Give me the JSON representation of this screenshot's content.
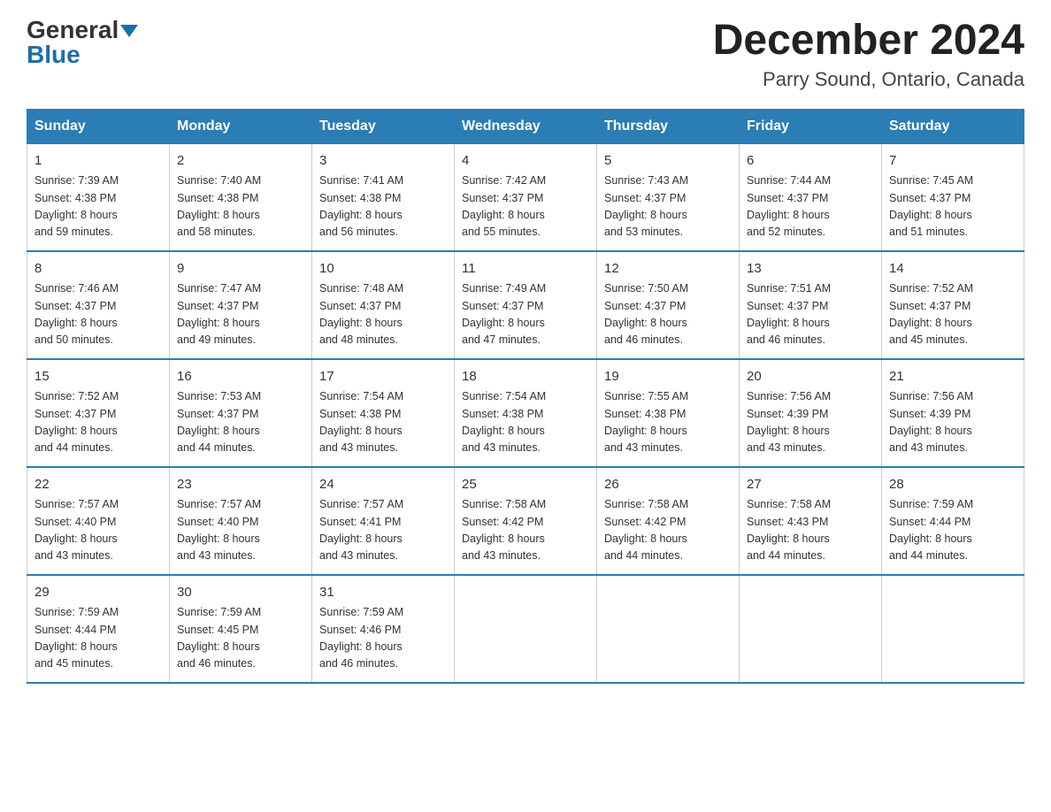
{
  "logo": {
    "general": "General",
    "blue": "Blue"
  },
  "title": "December 2024",
  "location": "Parry Sound, Ontario, Canada",
  "weekdays": [
    "Sunday",
    "Monday",
    "Tuesday",
    "Wednesday",
    "Thursday",
    "Friday",
    "Saturday"
  ],
  "weeks": [
    [
      {
        "day": "1",
        "sunrise": "7:39 AM",
        "sunset": "4:38 PM",
        "daylight": "8 hours and 59 minutes."
      },
      {
        "day": "2",
        "sunrise": "7:40 AM",
        "sunset": "4:38 PM",
        "daylight": "8 hours and 58 minutes."
      },
      {
        "day": "3",
        "sunrise": "7:41 AM",
        "sunset": "4:38 PM",
        "daylight": "8 hours and 56 minutes."
      },
      {
        "day": "4",
        "sunrise": "7:42 AM",
        "sunset": "4:37 PM",
        "daylight": "8 hours and 55 minutes."
      },
      {
        "day": "5",
        "sunrise": "7:43 AM",
        "sunset": "4:37 PM",
        "daylight": "8 hours and 53 minutes."
      },
      {
        "day": "6",
        "sunrise": "7:44 AM",
        "sunset": "4:37 PM",
        "daylight": "8 hours and 52 minutes."
      },
      {
        "day": "7",
        "sunrise": "7:45 AM",
        "sunset": "4:37 PM",
        "daylight": "8 hours and 51 minutes."
      }
    ],
    [
      {
        "day": "8",
        "sunrise": "7:46 AM",
        "sunset": "4:37 PM",
        "daylight": "8 hours and 50 minutes."
      },
      {
        "day": "9",
        "sunrise": "7:47 AM",
        "sunset": "4:37 PM",
        "daylight": "8 hours and 49 minutes."
      },
      {
        "day": "10",
        "sunrise": "7:48 AM",
        "sunset": "4:37 PM",
        "daylight": "8 hours and 48 minutes."
      },
      {
        "day": "11",
        "sunrise": "7:49 AM",
        "sunset": "4:37 PM",
        "daylight": "8 hours and 47 minutes."
      },
      {
        "day": "12",
        "sunrise": "7:50 AM",
        "sunset": "4:37 PM",
        "daylight": "8 hours and 46 minutes."
      },
      {
        "day": "13",
        "sunrise": "7:51 AM",
        "sunset": "4:37 PM",
        "daylight": "8 hours and 46 minutes."
      },
      {
        "day": "14",
        "sunrise": "7:52 AM",
        "sunset": "4:37 PM",
        "daylight": "8 hours and 45 minutes."
      }
    ],
    [
      {
        "day": "15",
        "sunrise": "7:52 AM",
        "sunset": "4:37 PM",
        "daylight": "8 hours and 44 minutes."
      },
      {
        "day": "16",
        "sunrise": "7:53 AM",
        "sunset": "4:37 PM",
        "daylight": "8 hours and 44 minutes."
      },
      {
        "day": "17",
        "sunrise": "7:54 AM",
        "sunset": "4:38 PM",
        "daylight": "8 hours and 43 minutes."
      },
      {
        "day": "18",
        "sunrise": "7:54 AM",
        "sunset": "4:38 PM",
        "daylight": "8 hours and 43 minutes."
      },
      {
        "day": "19",
        "sunrise": "7:55 AM",
        "sunset": "4:38 PM",
        "daylight": "8 hours and 43 minutes."
      },
      {
        "day": "20",
        "sunrise": "7:56 AM",
        "sunset": "4:39 PM",
        "daylight": "8 hours and 43 minutes."
      },
      {
        "day": "21",
        "sunrise": "7:56 AM",
        "sunset": "4:39 PM",
        "daylight": "8 hours and 43 minutes."
      }
    ],
    [
      {
        "day": "22",
        "sunrise": "7:57 AM",
        "sunset": "4:40 PM",
        "daylight": "8 hours and 43 minutes."
      },
      {
        "day": "23",
        "sunrise": "7:57 AM",
        "sunset": "4:40 PM",
        "daylight": "8 hours and 43 minutes."
      },
      {
        "day": "24",
        "sunrise": "7:57 AM",
        "sunset": "4:41 PM",
        "daylight": "8 hours and 43 minutes."
      },
      {
        "day": "25",
        "sunrise": "7:58 AM",
        "sunset": "4:42 PM",
        "daylight": "8 hours and 43 minutes."
      },
      {
        "day": "26",
        "sunrise": "7:58 AM",
        "sunset": "4:42 PM",
        "daylight": "8 hours and 44 minutes."
      },
      {
        "day": "27",
        "sunrise": "7:58 AM",
        "sunset": "4:43 PM",
        "daylight": "8 hours and 44 minutes."
      },
      {
        "day": "28",
        "sunrise": "7:59 AM",
        "sunset": "4:44 PM",
        "daylight": "8 hours and 44 minutes."
      }
    ],
    [
      {
        "day": "29",
        "sunrise": "7:59 AM",
        "sunset": "4:44 PM",
        "daylight": "8 hours and 45 minutes."
      },
      {
        "day": "30",
        "sunrise": "7:59 AM",
        "sunset": "4:45 PM",
        "daylight": "8 hours and 46 minutes."
      },
      {
        "day": "31",
        "sunrise": "7:59 AM",
        "sunset": "4:46 PM",
        "daylight": "8 hours and 46 minutes."
      },
      null,
      null,
      null,
      null
    ]
  ],
  "labels": {
    "sunrise": "Sunrise: ",
    "sunset": "Sunset: ",
    "daylight": "Daylight: "
  }
}
